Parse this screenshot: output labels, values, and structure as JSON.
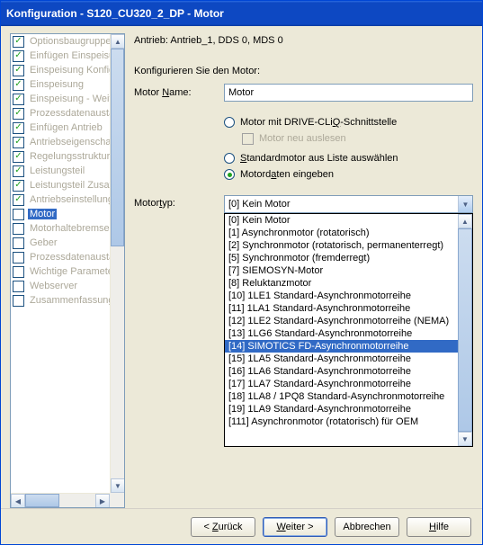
{
  "title": "Konfiguration - S120_CU320_2_DP - Motor",
  "tree": [
    {
      "label": "Optionsbaugruppe",
      "checked": true,
      "disabled": true
    },
    {
      "label": "Einfügen Einspeisu",
      "checked": true,
      "disabled": true
    },
    {
      "label": "Einspeisung Konfig",
      "checked": true,
      "disabled": true
    },
    {
      "label": "Einspeisung",
      "checked": true,
      "disabled": true
    },
    {
      "label": "Einspeisung - Weite",
      "checked": true,
      "disabled": true
    },
    {
      "label": "Prozessdatenausta",
      "checked": true,
      "disabled": true
    },
    {
      "label": "Einfügen Antrieb",
      "checked": true,
      "disabled": true
    },
    {
      "label": "Antriebseigenschaf",
      "checked": true,
      "disabled": true
    },
    {
      "label": "Regelungsstruktur",
      "checked": true,
      "disabled": true
    },
    {
      "label": "Leistungsteil",
      "checked": true,
      "disabled": true
    },
    {
      "label": "Leistungsteil Zusatz",
      "checked": true,
      "disabled": true
    },
    {
      "label": "Antriebseinstellung",
      "checked": true,
      "disabled": true
    },
    {
      "label": "Motor",
      "checked": false,
      "disabled": false,
      "selected": true
    },
    {
      "label": "Motorhaltebremse",
      "checked": false,
      "disabled": true
    },
    {
      "label": "Geber",
      "checked": false,
      "disabled": true
    },
    {
      "label": "Prozessdatenausta",
      "checked": false,
      "disabled": true
    },
    {
      "label": "Wichtige Parameter",
      "checked": false,
      "disabled": true
    },
    {
      "label": "Webserver",
      "checked": false,
      "disabled": true
    },
    {
      "label": "Zusammenfassung",
      "checked": false,
      "disabled": true
    }
  ],
  "heading": "Antrieb: Antrieb_1, DDS 0, MDS 0",
  "section_label": "Konfigurieren Sie den Motor:",
  "motor_name_label_pre": "Motor ",
  "motor_name_label_u": "N",
  "motor_name_label_post": "ame:",
  "motor_name_value": "Motor",
  "radios": {
    "r1_pre": "Motor mit DRIVE-CLi",
    "r1_u": "Q",
    "r1_post": "-Schnittstelle",
    "r1_sub": "Motor neu auslesen",
    "r2_u": "S",
    "r2_post": "tandardmotor aus Liste auswählen",
    "r3_pre": "Motord",
    "r3_u": "a",
    "r3_post": "ten eingeben"
  },
  "motortyp_label_pre": "Motor",
  "motortyp_label_u": "t",
  "motortyp_label_post": "yp:",
  "motortyp_value": "[0] Kein Motor",
  "dropdown": [
    "[0] Kein Motor",
    "[1] Asynchronmotor (rotatorisch)",
    "[2] Synchronmotor (rotatorisch, permanenterregt)",
    "[5] Synchronmotor (fremderregt)",
    "[7] SIEMOSYN-Motor",
    "[8] Reluktanzmotor",
    "[10] 1LE1 Standard-Asynchronmotorreihe",
    "[11] 1LA1 Standard-Asynchronmotorreihe",
    "[12] 1LE2 Standard-Asynchronmotorreihe (NEMA)",
    "[13] 1LG6 Standard-Asynchronmotorreihe",
    "[14] SIMOTICS FD-Asynchronmotorreihe",
    "[15] 1LA5 Standard-Asynchronmotorreihe",
    "[16] 1LA6 Standard-Asynchronmotorreihe",
    "[17] 1LA7 Standard-Asynchronmotorreihe",
    "[18] 1LA8 / 1PQ8 Standard-Asynchronmotorreihe",
    "[19] 1LA9 Standard-Asynchronmotorreihe",
    "[111] Asynchronmotor (rotatorisch) für OEM"
  ],
  "dropdown_highlight": 10,
  "footer": {
    "back_pre": "< ",
    "back_u": "Z",
    "back_post": "urück",
    "next_u": "W",
    "next_post": "eiter >",
    "cancel": "Abbrechen",
    "help_u": "H",
    "help_post": "ilfe"
  }
}
